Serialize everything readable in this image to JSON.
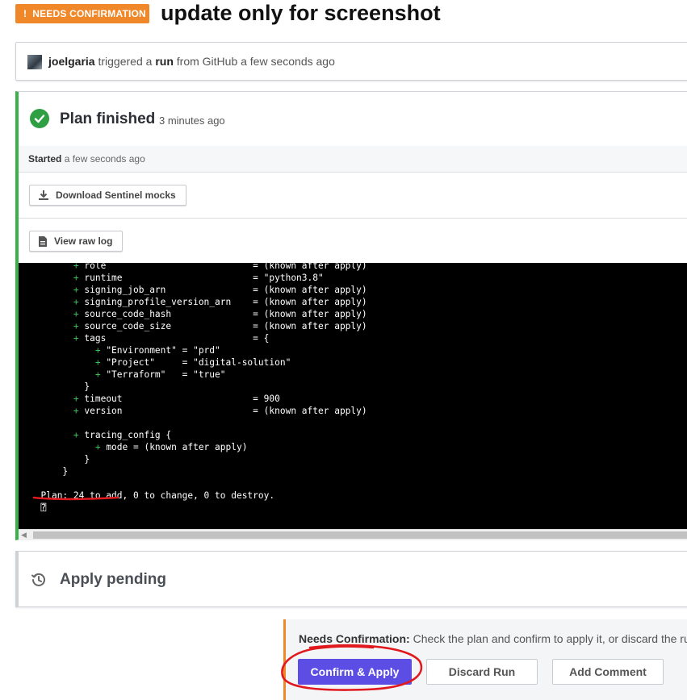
{
  "header": {
    "badge_icon": "!",
    "badge_label": "NEEDS CONFIRMATION",
    "badge_color": "#f0882a",
    "title": "update only for screenshot"
  },
  "trigger": {
    "user": "joelgaria",
    "pre": "triggered a",
    "action": "run",
    "post": "from GitHub a few seconds ago"
  },
  "plan": {
    "status_icon": "check-circle-icon",
    "title": "Plan finished",
    "time_ago": "3 minutes ago",
    "started_label": "Started",
    "started_value": "a few seconds ago",
    "download_button": "Download Sentinel mocks",
    "raw_log_button": "View raw log",
    "accent_color": "#3cb04a"
  },
  "terminal": {
    "lines": [
      {
        "indent": "        ",
        "plus": "+",
        "text": " role                           = (known after apply)"
      },
      {
        "indent": "        ",
        "plus": "+",
        "text": " runtime                        = \"python3.8\""
      },
      {
        "indent": "        ",
        "plus": "+",
        "text": " signing_job_arn                = (known after apply)"
      },
      {
        "indent": "        ",
        "plus": "+",
        "text": " signing_profile_version_arn    = (known after apply)"
      },
      {
        "indent": "        ",
        "plus": "+",
        "text": " source_code_hash               = (known after apply)"
      },
      {
        "indent": "        ",
        "plus": "+",
        "text": " source_code_size               = (known after apply)"
      },
      {
        "indent": "        ",
        "plus": "+",
        "text": " tags                           = {"
      },
      {
        "indent": "            ",
        "plus": "+",
        "text": " \"Environment\" = \"prd\""
      },
      {
        "indent": "            ",
        "plus": "+",
        "text": " \"Project\"     = \"digital-solution\""
      },
      {
        "indent": "            ",
        "plus": "+",
        "text": " \"Terraform\"   = \"true\""
      },
      {
        "indent": "          ",
        "plus": "",
        "text": "}"
      },
      {
        "indent": "        ",
        "plus": "+",
        "text": " timeout                        = 900"
      },
      {
        "indent": "        ",
        "plus": "+",
        "text": " version                        = (known after apply)"
      },
      {
        "indent": "",
        "plus": "",
        "text": ""
      },
      {
        "indent": "        ",
        "plus": "+",
        "text": " tracing_config {"
      },
      {
        "indent": "            ",
        "plus": "+",
        "text": " mode = (known after apply)"
      },
      {
        "indent": "          ",
        "plus": "",
        "text": "}"
      },
      {
        "indent": "      ",
        "plus": "",
        "text": "}"
      },
      {
        "indent": "",
        "plus": "",
        "text": ""
      },
      {
        "indent": "  ",
        "plus": "",
        "text": "Plan: 24 to add, 0 to change, 0 to destroy."
      },
      {
        "indent": "  ",
        "plus": "",
        "text": "⍰"
      }
    ]
  },
  "apply": {
    "icon": "clock-history-icon",
    "title": "Apply pending"
  },
  "confirmation": {
    "label": "Needs Confirmation:",
    "message": "Check the plan and confirm to apply it, or discard the ru",
    "confirm_button": "Confirm & Apply",
    "discard_button": "Discard Run",
    "comment_button": "Add Comment",
    "primary_color": "#5c4ee5",
    "annotation_color": "#e0191e"
  }
}
